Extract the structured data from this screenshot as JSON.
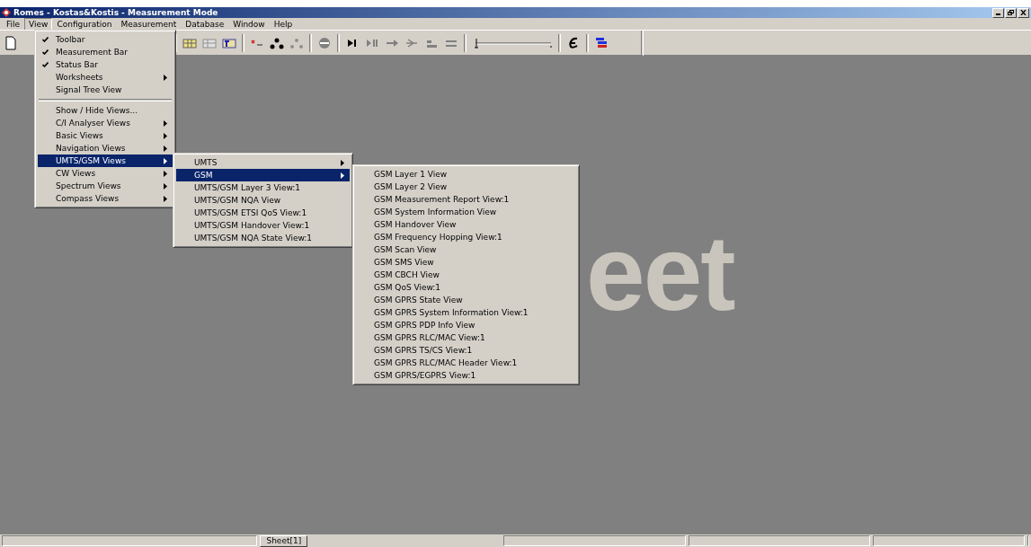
{
  "window": {
    "title": "Romes - Kostas&Kostis - Measurement Mode"
  },
  "menu_bar": [
    {
      "label": "File",
      "open": false
    },
    {
      "label": "View",
      "open": true
    },
    {
      "label": "Configuration",
      "open": false
    },
    {
      "label": "Measurement",
      "open": false
    },
    {
      "label": "Database",
      "open": false
    },
    {
      "label": "Window",
      "open": false
    },
    {
      "label": "Help",
      "open": false
    }
  ],
  "view_menu": [
    {
      "kind": "item",
      "label": "Toolbar",
      "checked": true,
      "has_submenu": false,
      "selected": false
    },
    {
      "kind": "item",
      "label": "Measurement Bar",
      "checked": true,
      "has_submenu": false,
      "selected": false
    },
    {
      "kind": "item",
      "label": "Status Bar",
      "checked": true,
      "has_submenu": false,
      "selected": false
    },
    {
      "kind": "item",
      "label": "Worksheets",
      "checked": false,
      "has_submenu": true,
      "selected": false
    },
    {
      "kind": "item",
      "label": "Signal Tree View",
      "checked": false,
      "has_submenu": false,
      "selected": false
    },
    {
      "kind": "separator"
    },
    {
      "kind": "item",
      "label": "Show / Hide Views...",
      "checked": false,
      "has_submenu": false,
      "selected": false
    },
    {
      "kind": "item",
      "label": "C/I Analyser Views",
      "checked": false,
      "has_submenu": true,
      "selected": false
    },
    {
      "kind": "item",
      "label": "Basic Views",
      "checked": false,
      "has_submenu": true,
      "selected": false
    },
    {
      "kind": "item",
      "label": "Navigation Views",
      "checked": false,
      "has_submenu": true,
      "selected": false
    },
    {
      "kind": "item",
      "label": "UMTS/GSM Views",
      "checked": false,
      "has_submenu": true,
      "selected": true
    },
    {
      "kind": "item",
      "label": "CW Views",
      "checked": false,
      "has_submenu": true,
      "selected": false
    },
    {
      "kind": "item",
      "label": "Spectrum Views",
      "checked": false,
      "has_submenu": true,
      "selected": false
    },
    {
      "kind": "item",
      "label": "Compass Views",
      "checked": false,
      "has_submenu": true,
      "selected": false
    }
  ],
  "umts_gsm_menu": [
    {
      "kind": "item",
      "label": "UMTS",
      "has_submenu": true,
      "selected": false
    },
    {
      "kind": "item",
      "label": "GSM",
      "has_submenu": true,
      "selected": true
    },
    {
      "kind": "item",
      "label": "UMTS/GSM Layer 3 View:1",
      "has_submenu": false,
      "selected": false
    },
    {
      "kind": "item",
      "label": "UMTS/GSM NQA View",
      "has_submenu": false,
      "selected": false
    },
    {
      "kind": "item",
      "label": "UMTS/GSM ETSI QoS View:1",
      "has_submenu": false,
      "selected": false
    },
    {
      "kind": "item",
      "label": "UMTS/GSM Handover View:1",
      "has_submenu": false,
      "selected": false
    },
    {
      "kind": "item",
      "label": "UMTS/GSM NQA State View:1",
      "has_submenu": false,
      "selected": false
    }
  ],
  "gsm_menu": [
    {
      "kind": "item",
      "label": "GSM Layer 1 View",
      "selected": false
    },
    {
      "kind": "item",
      "label": "GSM Layer 2 View",
      "selected": false
    },
    {
      "kind": "item",
      "label": "GSM Measurement Report View:1",
      "selected": false
    },
    {
      "kind": "item",
      "label": "GSM System Information View",
      "selected": false
    },
    {
      "kind": "item",
      "label": "GSM Handover View",
      "selected": false
    },
    {
      "kind": "item",
      "label": "GSM Frequency Hopping View:1",
      "selected": false
    },
    {
      "kind": "item",
      "label": "GSM Scan View",
      "selected": false
    },
    {
      "kind": "item",
      "label": "GSM SMS View",
      "selected": false
    },
    {
      "kind": "item",
      "label": "GSM CBCH View",
      "selected": false
    },
    {
      "kind": "item",
      "label": "GSM QoS View:1",
      "selected": false
    },
    {
      "kind": "item",
      "label": "GSM GPRS State View",
      "selected": false
    },
    {
      "kind": "item",
      "label": "GSM GPRS System Information View:1",
      "selected": false
    },
    {
      "kind": "item",
      "label": "GSM GPRS PDP Info View",
      "selected": false
    },
    {
      "kind": "item",
      "label": "GSM GPRS RLC/MAC View:1",
      "selected": false
    },
    {
      "kind": "item",
      "label": "GSM GPRS TS/CS View:1",
      "selected": false
    },
    {
      "kind": "item",
      "label": "GSM GPRS RLC/MAC Header View:1",
      "selected": false
    },
    {
      "kind": "item",
      "label": "GSM GPRS/EGPRS View:1",
      "selected": false
    }
  ],
  "toolbar": {
    "slider": {
      "level": 0
    }
  },
  "workspace": {
    "background_label": "eet"
  },
  "status_bar": {
    "sheet_tab": "Sheet[1]"
  }
}
